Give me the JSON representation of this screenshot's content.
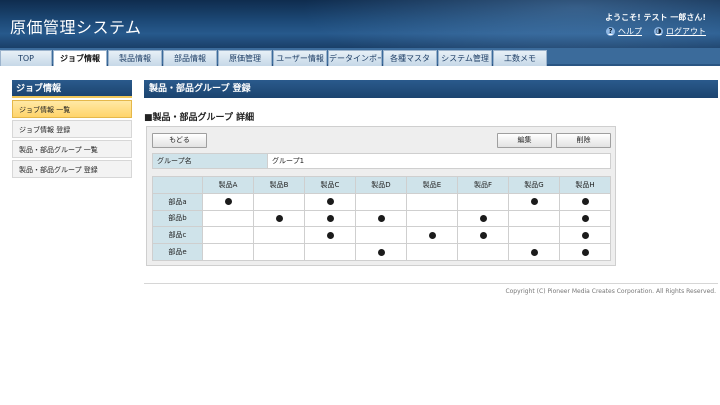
{
  "header": {
    "title": "原価管理システム",
    "welcome": "ようこそ! テスト 一郎さん!",
    "links": [
      {
        "label": "ヘルプ",
        "icon": "help-icon",
        "glyph": "?"
      },
      {
        "label": "ログアウト",
        "icon": "logout-icon",
        "glyph": "◑"
      }
    ]
  },
  "nav": {
    "tabs": [
      {
        "label": "TOP",
        "w": 52
      },
      {
        "label": "ジョブ情報",
        "w": 54,
        "active": true
      },
      {
        "label": "製品情報",
        "w": 54
      },
      {
        "label": "部品情報",
        "w": 54
      },
      {
        "label": "原価管理",
        "w": 54
      },
      {
        "label": "ユーザー情報",
        "w": 54
      },
      {
        "label": "データインポート",
        "w": 54
      },
      {
        "label": "各種マスタ",
        "w": 54
      },
      {
        "label": "システム管理",
        "w": 54
      },
      {
        "label": "工数メモ",
        "w": 54
      }
    ]
  },
  "sidebar": {
    "title": "ジョブ情報",
    "items": [
      {
        "label": "ジョブ情報 一覧",
        "active": true
      },
      {
        "label": "ジョブ情報 登録"
      },
      {
        "label": "製品・部品グループ 一覧"
      },
      {
        "label": "製品・部品グループ 登録"
      }
    ]
  },
  "main": {
    "title": "製品・部品グループ 登録",
    "subtitle": "■製品・部品グループ 詳細",
    "buttons": {
      "back": "もどる",
      "edit": "編集",
      "delete": "削除"
    },
    "group": {
      "label": "グループ名",
      "value": "グループ1"
    },
    "matrix": {
      "columns": [
        "製品A",
        "製品B",
        "製品C",
        "製品D",
        "製品E",
        "製品F",
        "製品G",
        "製品H"
      ],
      "rows": [
        {
          "label": "部品a",
          "marks": [
            1,
            0,
            1,
            0,
            0,
            0,
            1,
            1
          ]
        },
        {
          "label": "部品b",
          "marks": [
            0,
            1,
            1,
            1,
            0,
            1,
            0,
            1
          ]
        },
        {
          "label": "部品c",
          "marks": [
            0,
            0,
            1,
            0,
            1,
            1,
            0,
            1
          ]
        },
        {
          "label": "部品e",
          "marks": [
            0,
            0,
            0,
            1,
            0,
            0,
            1,
            1
          ]
        }
      ]
    }
  },
  "footer": {
    "copyright": "Copyright (C) Pioneer Media Creates Corporation. All Rights Reserved."
  }
}
